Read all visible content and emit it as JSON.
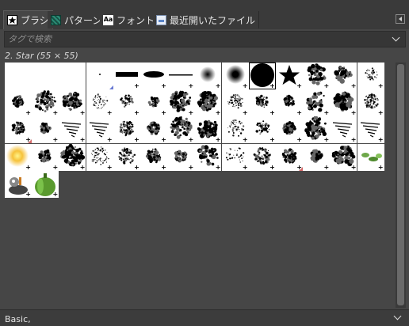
{
  "tabs": [
    {
      "label": "ブラシ",
      "icon": "brush-star-icon",
      "active": true
    },
    {
      "label": "パターン",
      "icon": "pattern-icon",
      "active": false
    },
    {
      "label": "フォント",
      "icon": "font-icon",
      "active": false
    },
    {
      "label": "最近開いたファイル",
      "icon": "document-history-icon",
      "active": false
    }
  ],
  "tag_filter": {
    "placeholder": "タグで検索",
    "value": ""
  },
  "selected_brush": "2. Star (55 × 55)",
  "brushes": [
    "brush",
    "brush",
    "brush",
    "brush",
    "brush",
    "brush",
    "brush",
    "brush",
    "brush",
    "brush",
    "brush",
    "brush",
    "brush",
    "brush",
    "brush",
    "brush",
    "brush",
    "brush",
    "brush",
    "brush",
    "brush",
    "brush",
    "brush",
    "brush",
    "brush",
    "brush",
    "brush",
    "brush",
    "brush",
    "brush",
    "brush",
    "brush",
    "brush",
    "brush",
    "brush",
    "brush",
    "brush",
    "brush",
    "brush",
    "brush",
    "brush",
    "brush",
    "brush",
    "brush",
    "brush",
    "brush",
    "brush",
    "brush",
    "brush",
    "brush",
    "brush",
    "brush",
    "brush",
    "brush",
    "brush",
    "brush",
    "brush",
    "brush"
  ],
  "tag_assign": {
    "value": "Basic,"
  },
  "colors": {
    "panel_bg": "#464646",
    "tab_bg": "#3a3a3a",
    "cell_bg": "#ffffff"
  }
}
